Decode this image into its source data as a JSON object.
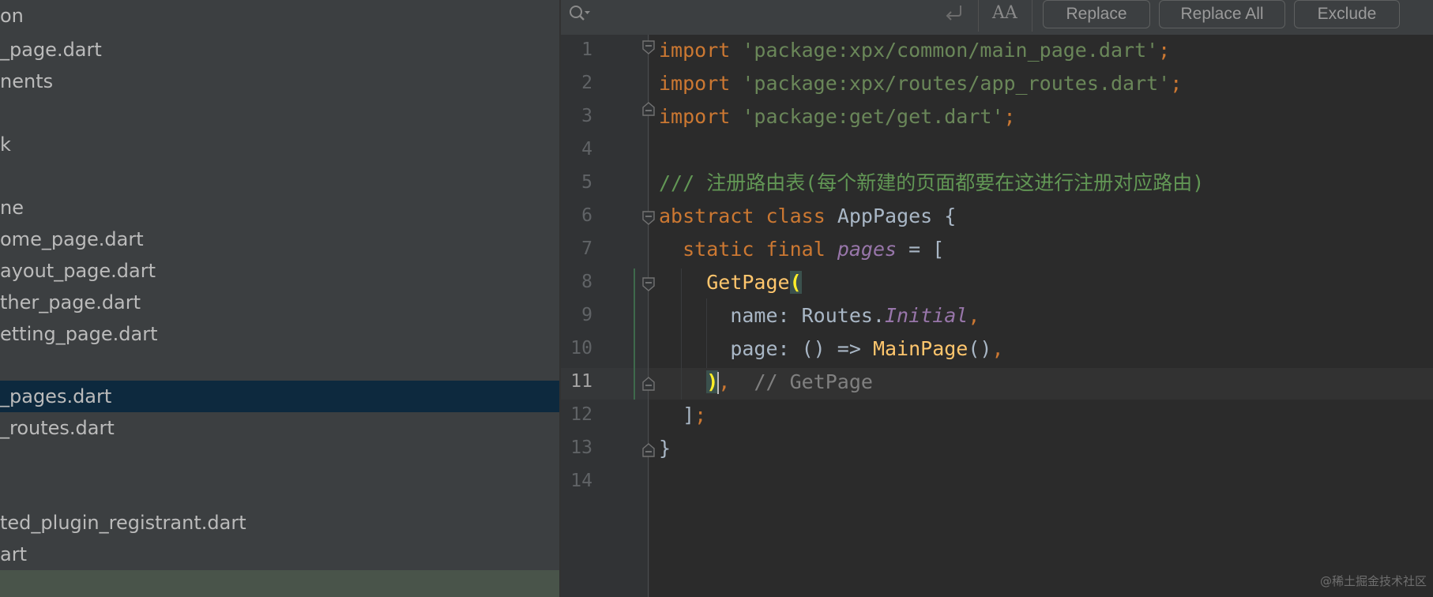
{
  "project_tree": {
    "items": [
      {
        "label": "on",
        "selected": false
      },
      {
        "label": "_page.dart",
        "selected": false
      },
      {
        "label": "nents",
        "selected": false
      },
      {
        "label": "",
        "selected": false
      },
      {
        "label": "k",
        "selected": false
      },
      {
        "label": "",
        "selected": false
      },
      {
        "label": "ne",
        "selected": false
      },
      {
        "label": "ome_page.dart",
        "selected": false
      },
      {
        "label": "ayout_page.dart",
        "selected": false
      },
      {
        "label": "ther_page.dart",
        "selected": false
      },
      {
        "label": "etting_page.dart",
        "selected": false
      },
      {
        "label": "",
        "selected": false
      },
      {
        "label": "_pages.dart",
        "selected": true
      },
      {
        "label": "_routes.dart",
        "selected": false
      },
      {
        "label": "",
        "selected": false
      },
      {
        "label": "",
        "selected": false
      },
      {
        "label": "ted_plugin_registrant.dart",
        "selected": false
      },
      {
        "label": "art",
        "selected": false
      }
    ]
  },
  "toolbar": {
    "case_icon_label": "AA",
    "replace_label": "Replace",
    "replace_all_label": "Replace All",
    "exclude_label": "Exclude"
  },
  "editor": {
    "line_numbers": [
      "1",
      "2",
      "3",
      "4",
      "5",
      "6",
      "7",
      "8",
      "9",
      "10",
      "11",
      "12",
      "13",
      "14"
    ],
    "current_line": "11",
    "code": {
      "l1_kw": "import",
      "l1_str": "'package:xpx/common/main_page.dart'",
      "l1_semi": ";",
      "l2_kw": "import",
      "l2_str": "'package:xpx/routes/app_routes.dart'",
      "l2_semi": ";",
      "l3_kw": "import",
      "l3_str": "'package:get/get.dart'",
      "l3_semi": ";",
      "l5_doc": "/// 注册路由表(每个新建的页面都要在这进行注册对应路由)",
      "l6_kw1": "abstract",
      "l6_kw2": "class",
      "l6_name": "AppPages",
      "l6_brace": "{",
      "l7_kw1": "static",
      "l7_kw2": "final",
      "l7_field": "pages",
      "l7_rest": "= [",
      "l8_fn": "GetPage",
      "l8_paren": "(",
      "l9_name": "name: Routes.",
      "l9_field": "Initial",
      "l9_comma": ",",
      "l10_page": "page: () => ",
      "l10_fn": "MainPage",
      "l10_call": "()",
      "l10_comma": ",",
      "l11_paren": ")",
      "l11_comma": ",",
      "l11_comment": "// GetPage",
      "l12_bracket": "]",
      "l12_semi": ";",
      "l13_brace": "}"
    }
  },
  "watermark": "@稀土掘金技术社区"
}
